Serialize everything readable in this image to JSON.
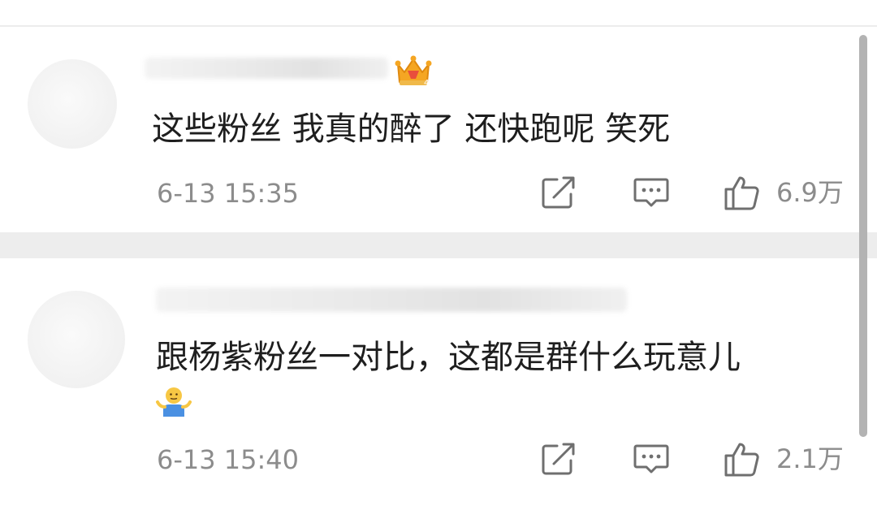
{
  "comments": [
    {
      "text": "这些粉丝 我真的醉了 还快跑呢 笑死",
      "badge_icon": "crown-badge-icon",
      "timestamp": "6-13 15:35",
      "likes": "6.9万"
    },
    {
      "text": "跟杨紫粉丝一对比，这都是群什么玩意儿",
      "emoji_icon": "shrug-emoji-icon",
      "timestamp": "6-13 15:40",
      "likes": "2.1万"
    }
  ],
  "colors": {
    "text": "#1e1e1e",
    "meta": "#8c8c8c",
    "divider": "#ededed",
    "crown": "#f5a623",
    "scrollbar": "#b3b3b3"
  }
}
